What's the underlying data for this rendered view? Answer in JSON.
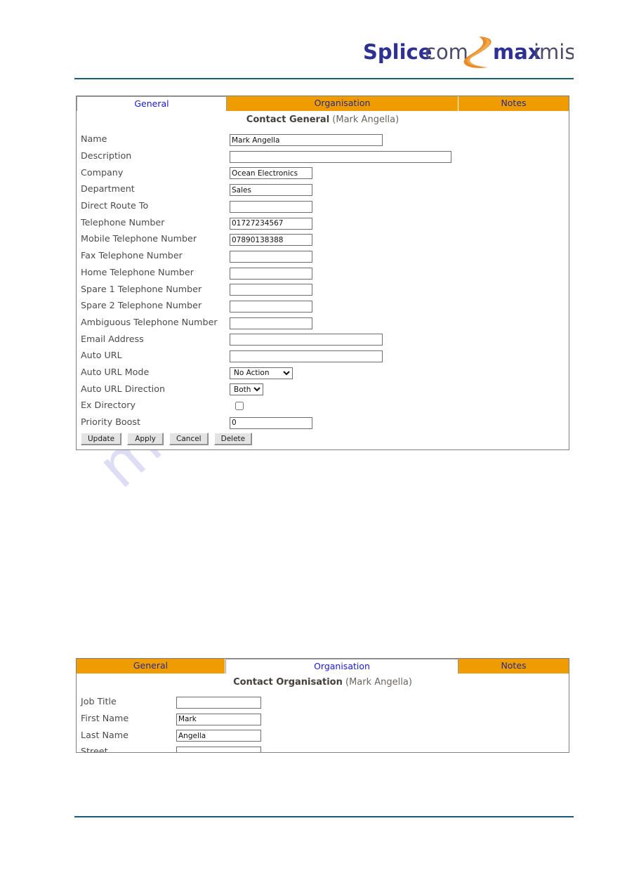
{
  "brand": {
    "logo_part1": "Splice",
    "logo_part2": "com",
    "logo_part3": "max",
    "logo_part4": "imiser",
    "logo_name": "splicecom-maximiser-logo"
  },
  "watermark": {
    "text": "manualshive.com"
  },
  "colors": {
    "tab_orange": "#EE9C00",
    "tab_active_text": "#1A1AD0",
    "rule": "#1B5A78",
    "logo_blue": "#2E3192",
    "logo_orange": "#E98B2A",
    "watermark": "#C9C9EF"
  },
  "general_form": {
    "tabs": [
      {
        "label": "General",
        "active": true
      },
      {
        "label": "Organisation",
        "active": false
      },
      {
        "label": "Notes",
        "active": false
      }
    ],
    "title_bold": "Contact General",
    "title_subject": "(Mark Angella)",
    "fields": [
      {
        "label": "Name",
        "type": "text",
        "value": "Mark Angella",
        "width": "w-name"
      },
      {
        "label": "Description",
        "type": "text",
        "value": "",
        "width": "w-desc"
      },
      {
        "label": "Company",
        "type": "text",
        "value": "Ocean Electronics",
        "width": "w-small"
      },
      {
        "label": "Department",
        "type": "text",
        "value": "Sales",
        "width": "w-small"
      },
      {
        "label": "Direct Route To",
        "type": "text",
        "value": "",
        "width": "w-small"
      },
      {
        "label": "Telephone Number",
        "type": "text",
        "value": "01727234567",
        "width": "w-small"
      },
      {
        "label": "Mobile Telephone Number",
        "type": "text",
        "value": "07890138388",
        "width": "w-small"
      },
      {
        "label": "Fax Telephone Number",
        "type": "text",
        "value": "",
        "width": "w-small"
      },
      {
        "label": "Home Telephone Number",
        "type": "text",
        "value": "",
        "width": "w-small"
      },
      {
        "label": "Spare 1 Telephone Number",
        "type": "text",
        "value": "",
        "width": "w-small"
      },
      {
        "label": "Spare 2 Telephone Number",
        "type": "text",
        "value": "",
        "width": "w-small"
      },
      {
        "label": "Ambiguous Telephone Number",
        "type": "text",
        "value": "",
        "width": "w-small"
      },
      {
        "label": "Email Address",
        "type": "text",
        "value": "",
        "width": "w-mid"
      },
      {
        "label": "Auto URL",
        "type": "text",
        "value": "",
        "width": "w-mid"
      },
      {
        "label": "Auto URL Mode",
        "type": "select",
        "value": "No Action",
        "width": "w-mode"
      },
      {
        "label": "Auto URL Direction",
        "type": "select",
        "value": "Both",
        "width": "w-dir"
      },
      {
        "label": "Ex Directory",
        "type": "checkbox",
        "checked": false
      },
      {
        "label": "Priority Boost",
        "type": "text",
        "value": "0",
        "width": "w-small"
      }
    ],
    "buttons": [
      {
        "label": "Update"
      },
      {
        "label": "Apply"
      },
      {
        "label": "Cancel"
      },
      {
        "label": "Delete"
      }
    ]
  },
  "organisation_form": {
    "tabs": [
      {
        "label": "General",
        "active": false
      },
      {
        "label": "Organisation",
        "active": true
      },
      {
        "label": "Notes",
        "active": false
      }
    ],
    "title_bold": "Contact Organisation",
    "title_subject": "(Mark Angella)",
    "fields": [
      {
        "label": "Job Title",
        "type": "text",
        "value": "",
        "width": "w-name"
      },
      {
        "label": "First Name",
        "type": "text",
        "value": "Mark",
        "width": "w-name"
      },
      {
        "label": "Last Name",
        "type": "text",
        "value": "Angella",
        "width": "w-name"
      },
      {
        "label": "Street",
        "type": "text",
        "value": "",
        "width": "w-name"
      }
    ]
  }
}
